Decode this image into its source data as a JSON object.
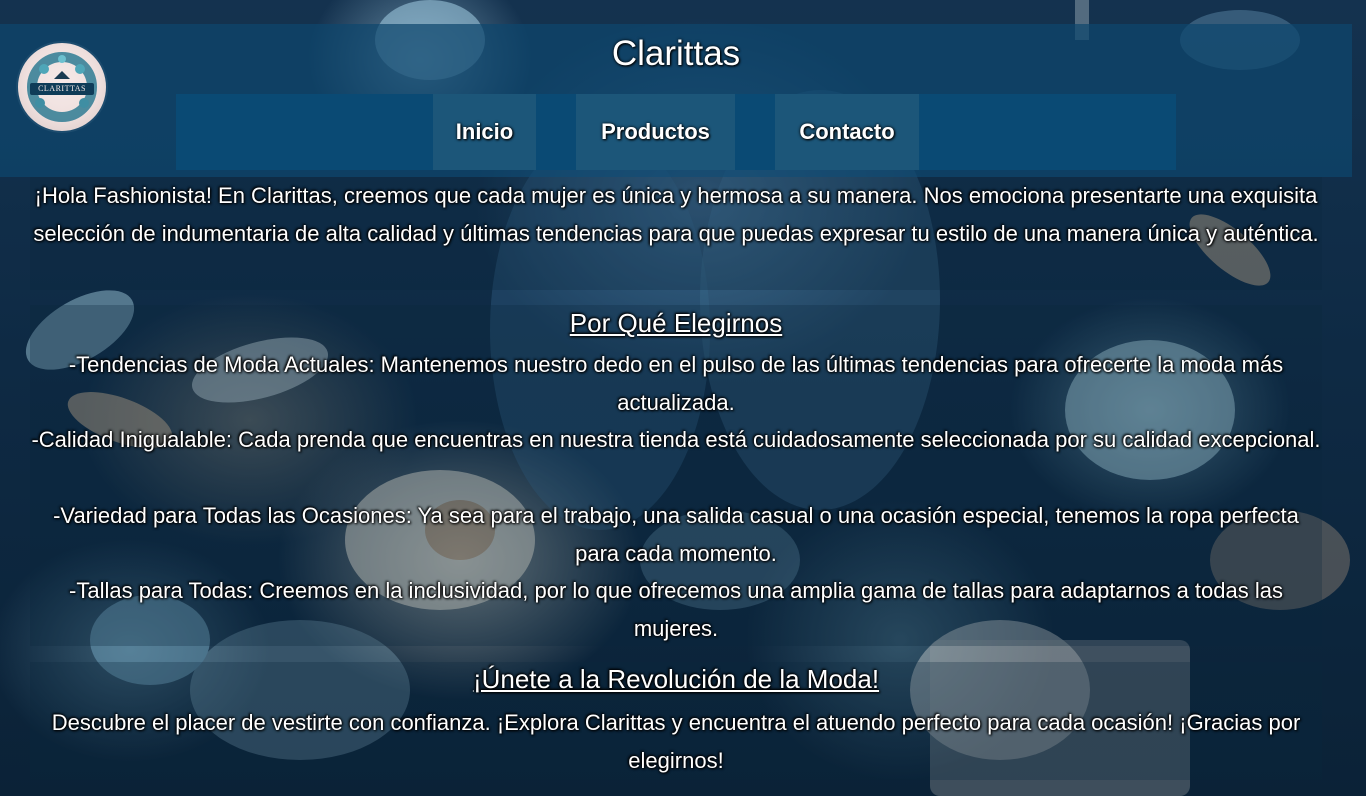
{
  "header": {
    "title": "Clarittas",
    "logo_text": "CLARITTAS"
  },
  "nav": {
    "items": [
      {
        "label": "Inicio"
      },
      {
        "label": "Productos"
      },
      {
        "label": "Contacto"
      }
    ]
  },
  "intro": {
    "text": "¡Hola Fashionista! En Clarittas, creemos que cada mujer es única y hermosa a su manera. Nos emociona presentarte una exquisita selección de indumentaria de alta calidad y últimas tendencias para que puedas expresar tu estilo de una manera única y auténtica."
  },
  "why": {
    "heading": "Por Qué Elegirnos",
    "items": [
      "-Tendencias de Moda Actuales: Mantenemos nuestro dedo en el pulso de las últimas tendencias para ofrecerte la moda más actualizada.",
      "-Calidad Inigualable: Cada prenda que encuentras en nuestra tienda está cuidadosamente seleccionada por su calidad excepcional.",
      "-Variedad para Todas las Ocasiones: Ya sea para el trabajo, una salida casual o una ocasión especial, tenemos la ropa perfecta para cada momento.",
      "-Tallas para Todas: Creemos en la inclusividad, por lo que ofrecemos una amplia gama de tallas para adaptarnos a todas las mujeres."
    ]
  },
  "join": {
    "heading": "¡Únete a la Revolución de la Moda!",
    "text": "Descubre el placer de vestirte con confianza. ¡Explora Clarittas y encuentra el atuendo perfecto para cada ocasión! ¡Gracias por elegirnos!"
  },
  "colors": {
    "header_bg": "#0e466e",
    "nav_bg": "#0a4a74",
    "nav_item_bg": "#1c5679",
    "text": "#ffffff"
  }
}
